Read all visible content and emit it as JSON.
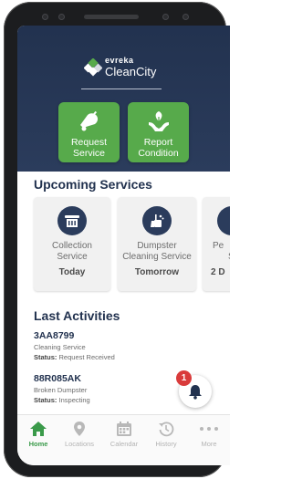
{
  "app": {
    "brand_top": "evreka",
    "brand_bottom": "CleanCity"
  },
  "actions": [
    {
      "line1": "Request",
      "line2": "Service",
      "icon": "bell-icon"
    },
    {
      "line1": "Report",
      "line2": "Condition",
      "icon": "hand-leaf-icon"
    }
  ],
  "upcoming": {
    "title": "Upcoming Services",
    "cards": [
      {
        "line1": "Collection",
        "line2": "Service",
        "day": "Today",
        "icon": "bin-icon"
      },
      {
        "line1": "Dumpster",
        "line2": "Cleaning Service",
        "day": "Tomorrow",
        "icon": "cleaning-icon"
      },
      {
        "line1": "Pe",
        "line2": "S",
        "day": "2 D"
      }
    ]
  },
  "activities": {
    "title": "Last Activities",
    "items": [
      {
        "id": "3AA8799",
        "desc": "Cleaning Service",
        "status_label": "Status:",
        "status": "Request Received"
      },
      {
        "id": "88R085AK",
        "desc": "Broken Dumpster",
        "status_label": "Status:",
        "status": "Inspecting"
      }
    ]
  },
  "notifications": {
    "count": "1"
  },
  "nav": [
    {
      "label": "Home",
      "icon": "home-icon",
      "active": true
    },
    {
      "label": "Locations",
      "icon": "location-pin-icon"
    },
    {
      "label": "Calendar",
      "icon": "calendar-icon"
    },
    {
      "label": "History",
      "icon": "history-icon"
    },
    {
      "label": "More",
      "icon": "more-icon"
    }
  ],
  "colors": {
    "header": "#22324f",
    "accent_green": "#57aa4b",
    "badge_red": "#d93b3b"
  }
}
